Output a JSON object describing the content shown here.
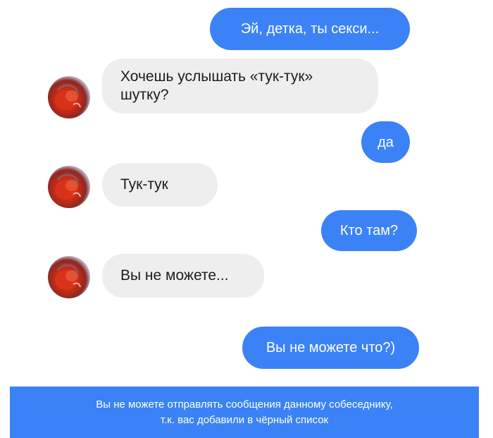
{
  "messages": [
    {
      "side": "outgoing",
      "text": "Эй, детка, ты секси..."
    },
    {
      "side": "incoming",
      "text": "Хочешь услышать «тук-тук»\nшутку?"
    },
    {
      "side": "outgoing",
      "text": "да"
    },
    {
      "side": "incoming",
      "text": "Тук-тук"
    },
    {
      "side": "outgoing",
      "text": "Кто там?"
    },
    {
      "side": "incoming",
      "text": "Вы не можете..."
    },
    {
      "side": "outgoing",
      "text": "Вы не можете что?)"
    }
  ],
  "banner": {
    "text": "Вы не можете отправлять сообщения данному собеседнику,\nт.к. вас добавили в чёрный список"
  },
  "colors": {
    "outgoing_bubble": "#3b82f6",
    "incoming_bubble": "#eeeeee",
    "banner": "#3b82f6"
  }
}
